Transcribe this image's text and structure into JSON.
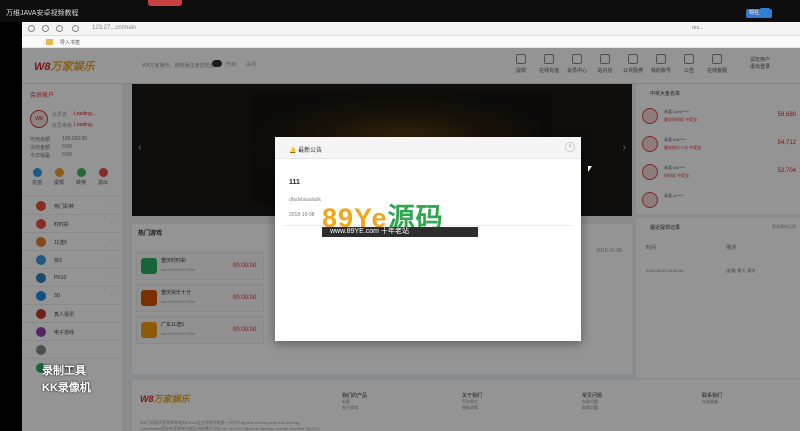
{
  "recorder": {
    "title": "万维JAVA安卓视频教程",
    "right_button": "现在上传"
  },
  "browser": {
    "url": "123.27...cn/main",
    "bookmark": "导入书签",
    "right_label": "res..."
  },
  "header": {
    "logo_a": "W8",
    "logo_b": "万家娱乐",
    "notice": "W8万家娱乐，刚刚版注册送现金",
    "toggle_label": "开启",
    "toggle_label2": "关闭",
    "nav": [
      "提现",
      "在线充值",
      "会员中心",
      "站内信",
      "11奖励券",
      "我的账号",
      "公告",
      "在线客服"
    ],
    "user_line1": "试玩用户",
    "user_line2": "退出登录"
  },
  "left": {
    "title": "会员账户",
    "avatar": "W8",
    "user_name_label": "会员名",
    "user_name": "Loading...",
    "level_label": "会员等级",
    "level": "Loading..",
    "balance_label": "可用余额",
    "balance": "100,000.00",
    "frozen_label": "冻结金额",
    "frozen": "0.00",
    "points_label": "今日输赢",
    "points": "0.00",
    "quick": [
      "充值",
      "提现",
      "转换",
      "退出"
    ],
    "menu": [
      "热门彩种",
      "时时彩",
      "11选5",
      "快3",
      "PK10",
      "3D",
      "真人视讯",
      "电子游戏",
      "",
      "体育竞猜"
    ]
  },
  "hot": {
    "title": "热门游戏",
    "games": [
      {
        "name": "重庆时时彩",
        "sub": "No.00000000-0000",
        "countdown": "00:00:00"
      },
      {
        "name": "重庆快乐十分",
        "sub": "No.00000000-0000",
        "countdown": "00:00:00"
      },
      {
        "name": "广东11选5",
        "sub": "No.00000000-0000",
        "countdown": "00:00:00"
      }
    ]
  },
  "midtable": {
    "date": "2018-01-08"
  },
  "winners": {
    "title": "中奖大金名单",
    "rows": [
      {
        "user": "恭喜 Lyme****",
        "game": "重庆时时彩 中奖金",
        "amount": "58,680"
      },
      {
        "user": "恭喜 bob****",
        "game": "重庆快乐十分 中奖金",
        "amount": "54,712"
      },
      {
        "user": "恭喜 kkk****",
        "game": "时时彩 中奖金",
        "amount": "52,704"
      },
      {
        "user": "恭喜 zz****",
        "game": "",
        "amount": ""
      }
    ]
  },
  "withdraw": {
    "title": "最近提现记录",
    "more": "更多最新记录",
    "col1": "时间",
    "col2": "描述",
    "row_date": "2018-06-23 16:48:34",
    "row_desc": "[彩票] 黄大, 黄木"
  },
  "footer": {
    "logo_a": "W8",
    "logo_b": "万家娱乐",
    "cols": [
      {
        "title": "我们的产品",
        "items": [
          "彩票",
          "电子游戏",
          "体育竞猜",
          "视讯游戏"
        ]
      },
      {
        "title": "关于我们",
        "items": [
          "平台简介",
          "隐私政策",
          "免责声明",
          "联系我们"
        ]
      },
      {
        "title": "常见问题",
        "items": [
          "存款问题",
          "取款问题",
          "彩票问题",
          "账户问题"
        ]
      },
      {
        "title": "联系我们",
        "items": [
          "在线客服"
        ]
      }
    ],
    "text": "W8万家娱乐是菲律宾政府CEZA官方授权持有第一卡托Philippine Amusement and Gaming Corporation颁发的菲律宾网络证书经营许可证 NO.16-012 Offshore Gaming License (Number 16-012) 版权所有"
  },
  "modal": {
    "title": "最新公告",
    "close": "×",
    "ann_title": "111",
    "ann_body": "dfadslalaaladk",
    "ann_date": "2018-10-08"
  },
  "watermark": {
    "big_a": "89Ye",
    "big_b": "源码",
    "sub": "www.89YE.com 十年老站",
    "rec_line1": "录制工具",
    "rec_line2": "KK录像机"
  }
}
